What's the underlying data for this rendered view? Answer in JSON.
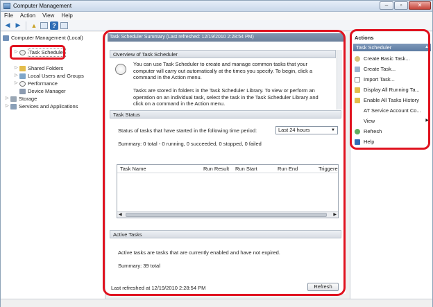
{
  "window": {
    "title": "Computer Management"
  },
  "menubar": [
    "File",
    "Action",
    "View",
    "Help"
  ],
  "tree": {
    "root": "Computer Management (Local)",
    "items": [
      {
        "label": "Task Scheduler"
      },
      {
        "label": "Shared Folders"
      },
      {
        "label": "Local Users and Groups"
      },
      {
        "label": "Performance"
      },
      {
        "label": "Device Manager"
      },
      {
        "label": "Storage"
      },
      {
        "label": "Services and Applications"
      }
    ]
  },
  "center": {
    "header": "Task Scheduler Summary (Last refreshed: 12/19/2010 2:28:54 PM)",
    "overview": {
      "title": "Overview of Task Scheduler",
      "p1": "You can use Task Scheduler to create and manage common tasks that your computer will carry out automatically at the times you specify. To begin, click a command in the Action menu.",
      "p2": "Tasks are stored in folders in the Task Scheduler Library. To view or perform an operation on an individual task, select the task in the Task Scheduler Library and click on a command in the Action menu."
    },
    "status": {
      "title": "Task Status",
      "prompt": "Status of tasks that have started in the following time period:",
      "period": "Last 24 hours",
      "summary": "Summary: 0 total - 0 running, 0 succeeded, 0 stopped, 0 failed",
      "columns": [
        "Task Name",
        "Run Result",
        "Run Start",
        "Run End",
        "Triggere"
      ]
    },
    "active": {
      "title": "Active Tasks",
      "text": "Active tasks are tasks that are currently enabled and have not expired.",
      "summary": "Summary: 39 total"
    },
    "footer": {
      "last_refreshed": "Last refreshed at 12/19/2010 2:28:54 PM",
      "refresh_label": "Refresh"
    }
  },
  "actions": {
    "title": "Actions",
    "group": "Task Scheduler",
    "items": [
      {
        "label": "Create Basic Task...",
        "icon": "create-basic-task-icon"
      },
      {
        "label": "Create Task...",
        "icon": "create-task-icon"
      },
      {
        "label": "Import Task...",
        "icon": "import-icon"
      },
      {
        "label": "Display All Running Ta...",
        "icon": "running-tasks-icon"
      },
      {
        "label": "Enable All Tasks History",
        "icon": "history-icon"
      },
      {
        "label": "AT Service Account Co...",
        "icon": ""
      },
      {
        "label": "View",
        "icon": ""
      },
      {
        "label": "Refresh",
        "icon": "refresh-icon"
      },
      {
        "label": "Help",
        "icon": "help-icon"
      }
    ]
  },
  "colors": {
    "highlight_ring": "#e0121f",
    "header_blue": "#6c819c"
  }
}
